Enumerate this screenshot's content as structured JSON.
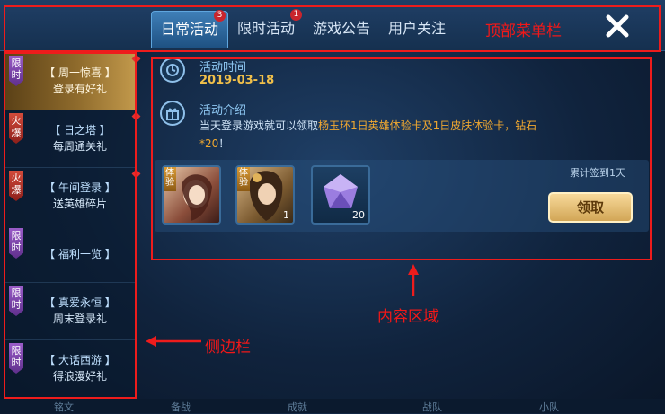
{
  "top_menu": {
    "tabs": [
      {
        "label": "日常活动",
        "badge": "3",
        "active": true
      },
      {
        "label": "限时活动",
        "badge": "1",
        "active": false
      },
      {
        "label": "游戏公告",
        "badge": "",
        "active": false
      },
      {
        "label": "用户关注",
        "badge": "",
        "active": false
      }
    ],
    "close_icon": "close-icon"
  },
  "sidebar": {
    "items": [
      {
        "tag": "限时",
        "tag_color": "#7a3fb0",
        "title": "【 周一惊喜 】",
        "subtitle": "登录有好礼",
        "active": true,
        "red_dot": true
      },
      {
        "tag": "火爆",
        "tag_color": "#b8332a",
        "title": "【 日之塔 】",
        "subtitle": "每周通关礼",
        "active": false,
        "red_dot": true
      },
      {
        "tag": "火爆",
        "tag_color": "#b8332a",
        "title": "【 午间登录 】",
        "subtitle": "送英雄碎片",
        "active": false,
        "red_dot": true
      },
      {
        "tag": "限时",
        "tag_color": "#7a3fb0",
        "title": "【 福利一览 】",
        "subtitle": "",
        "active": false,
        "red_dot": false
      },
      {
        "tag": "限时",
        "tag_color": "#7a3fb0",
        "title": "【 真爱永恒 】",
        "subtitle": "周末登录礼",
        "active": false,
        "red_dot": false
      },
      {
        "tag": "限时",
        "tag_color": "#7a3fb0",
        "title": "【 大话西游 】",
        "subtitle": "得浪漫好礼",
        "active": false,
        "red_dot": false
      }
    ]
  },
  "content": {
    "time_label": "活动时间",
    "date": "2019-03-18",
    "intro_label": "活动介绍",
    "intro_prefix": "当天登录游戏就可以领取",
    "intro_highlight": "杨玉环1日英雄体验卡及1日皮肤体验卡，钻石*20",
    "intro_suffix": "！",
    "rewards": [
      {
        "tag": "体验",
        "name": "hero-trial-card-icon",
        "count": ""
      },
      {
        "tag": "体验",
        "name": "skin-trial-card-icon",
        "count": "1"
      },
      {
        "tag": "",
        "name": "diamond-icon",
        "count": "20"
      }
    ],
    "sign_text": "累计签到1天",
    "claim_label": "领取"
  },
  "annotations": {
    "top_menu_label": "顶部菜单栏",
    "content_label": "内容区域",
    "sidebar_label": "侧边栏",
    "color": "#ee1c1c"
  },
  "bottom_bar": [
    "铭文",
    "备战",
    "成就",
    "战队",
    "小队"
  ]
}
